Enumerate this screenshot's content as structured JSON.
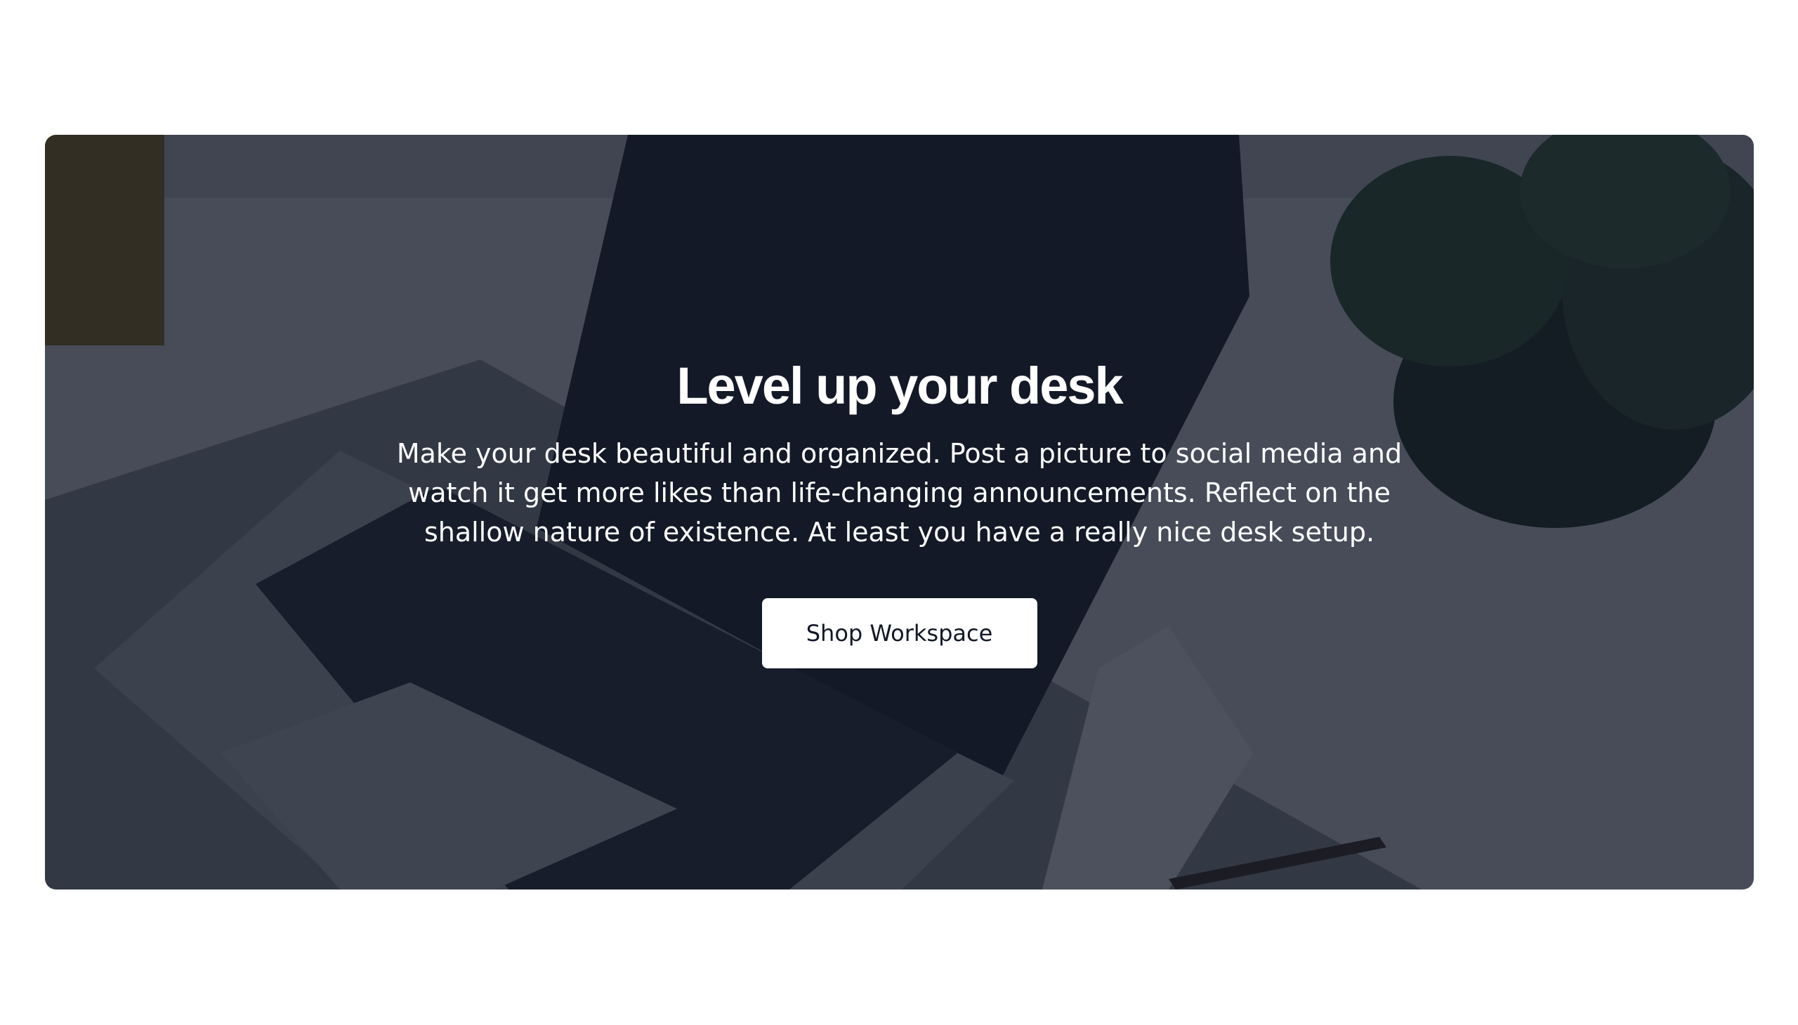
{
  "hero": {
    "title": "Level up your desk",
    "description": "Make your desk beautiful and organized. Post a picture to social media and watch it get more likes than life-changing announcements. Reflect on the shallow nature of existence. At least you have a really nice desk setup.",
    "button_label": "Shop Workspace"
  },
  "colors": {
    "overlay": "#111827",
    "button_background": "#ffffff",
    "button_text": "#111827",
    "page_background": "#ffffff"
  },
  "background_image": {
    "subject": "desk-workspace-photo",
    "depicts": [
      "laptop",
      "keyboard",
      "felt-desk-mat",
      "plant",
      "glass",
      "notepad",
      "pen"
    ]
  }
}
